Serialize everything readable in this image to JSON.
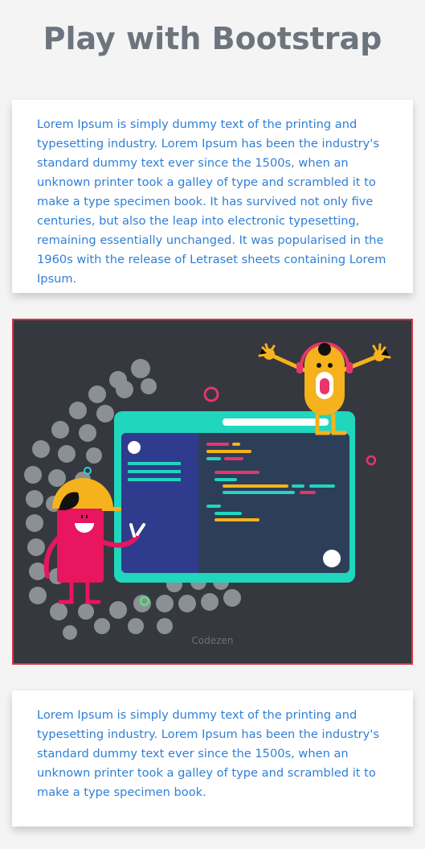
{
  "header": {
    "title": "Play with Bootstrap"
  },
  "cards": [
    {
      "text": "Lorem Ipsum is simply dummy text of the printing and typesetting industry. Lorem Ipsum has been the industry's standard dummy text ever since the 1500s, when an unknown printer took a galley of type and scrambled it to make a type specimen book. It has survived not only five centuries, but also the leap into electronic typesetting, remaining essentially unchanged. It was popularised in the 1960s with the release of Letraset sheets containing Lorem Ipsum."
    },
    {
      "text": "Lorem Ipsum is simply dummy text of the printing and typesetting industry. Lorem Ipsum has been the industry's standard dummy text ever since the 1500s, when an unknown printer took a galley of type and scrambled it to make a type specimen book."
    }
  ],
  "illustration": {
    "caption": "Codezen",
    "icon": "coding-illustration",
    "colors": {
      "background": "#35383f",
      "border": "#d9343e",
      "text": "#2f7fd6",
      "title": "#6c757d"
    }
  }
}
